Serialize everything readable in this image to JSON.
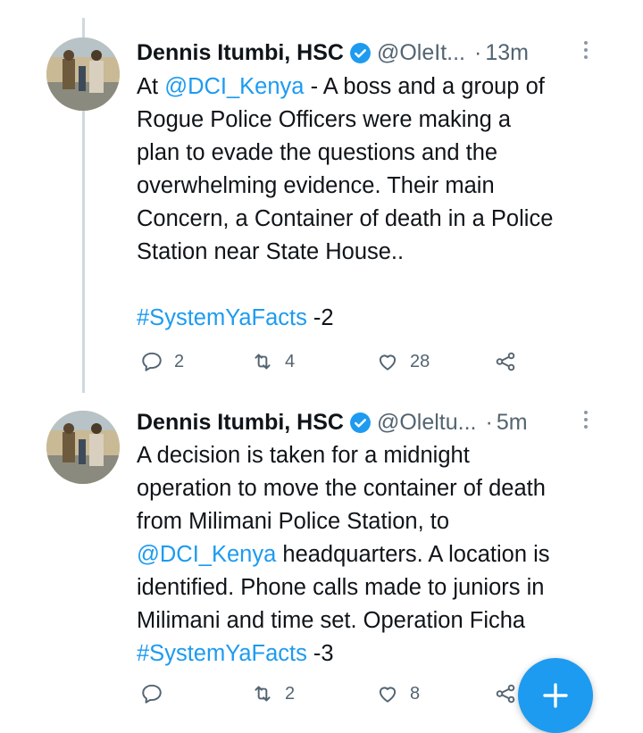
{
  "tweets": [
    {
      "author": "Dennis Itumbi, HSC",
      "handle": "@OleIt...",
      "dot": "·",
      "time": "13m",
      "lines": [
        [
          {
            "t": "At "
          },
          {
            "t": "@DCI_Kenya",
            "link": true
          },
          {
            "t": " - A boss and a group of"
          }
        ],
        [
          {
            "t": "Rogue Police Officers were making a"
          }
        ],
        [
          {
            "t": "plan to evade the questions and the"
          }
        ],
        [
          {
            "t": "overwhelming evidence. Their main"
          }
        ],
        [
          {
            "t": "Concern, a Container of death in a Police"
          }
        ],
        [
          {
            "t": "Station near State House.."
          }
        ],
        [
          {
            "t": ""
          }
        ],
        [
          {
            "t": "#SystemYaFacts",
            "link": true
          },
          {
            "t": " -2"
          }
        ]
      ],
      "actions": {
        "reply": "2",
        "retweet": "4",
        "like": "28",
        "share": ""
      }
    },
    {
      "author": "Dennis Itumbi, HSC",
      "handle": "@Oleltu...",
      "dot": "·",
      "time": "5m",
      "lines": [
        [
          {
            "t": "A decision is taken for a midnight"
          }
        ],
        [
          {
            "t": "operation to move the container of death"
          }
        ],
        [
          {
            "t": "from Milimani Police Station, to"
          }
        ],
        [
          {
            "t": "@DCI_Kenya",
            "link": true
          },
          {
            "t": " headquarters. A location is"
          }
        ],
        [
          {
            "t": "identified. Phone calls made to juniors in"
          }
        ],
        [
          {
            "t": "Milimani and time set. Operation Ficha"
          }
        ],
        [
          {
            "t": "#SystemYaFacts",
            "link": true
          },
          {
            "t": " -3"
          }
        ]
      ],
      "actions": {
        "reply": "",
        "retweet": "2",
        "like": "8",
        "share": ""
      }
    }
  ],
  "icons": {
    "verified": "verified-badge-icon",
    "more": "more-icon",
    "reply": "reply-icon",
    "retweet": "retweet-icon",
    "like": "like-icon",
    "share": "share-icon",
    "compose": "plus-icon"
  },
  "colors": {
    "link": "#1d9bf0",
    "muted": "#536471",
    "fab": "#1d9bf0"
  }
}
